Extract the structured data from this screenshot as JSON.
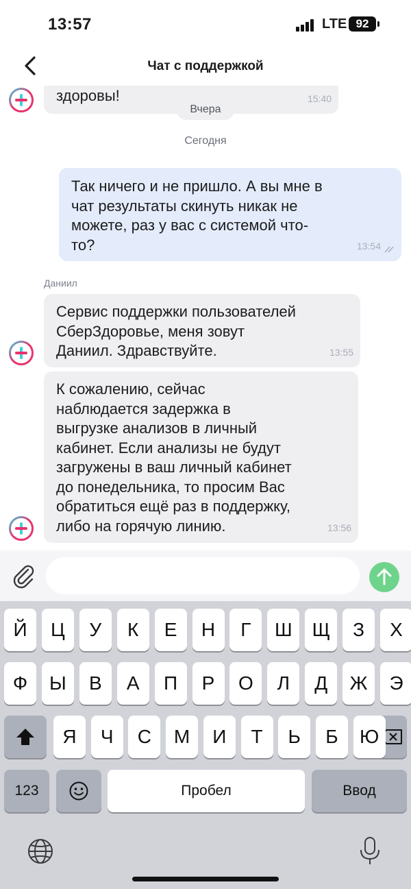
{
  "status_bar": {
    "time": "13:57",
    "network": "LTE",
    "battery": "92"
  },
  "header": {
    "title": "Чат с поддержкой"
  },
  "chat": {
    "prev_message": {
      "text": "здоровы!",
      "time": "15:40"
    },
    "day_yesterday": "Вчера",
    "day_today": "Сегодня",
    "outgoing": {
      "text": "Так ничего и не пришло. А вы мне в\nчат результаты скинуть никак не\nможете, раз у вас с системой что-\nто?",
      "time": "13:54"
    },
    "sender_name": "Даниил",
    "incoming": [
      {
        "text": "Сервис поддержки пользователей\nСберЗдоровье, меня зовут\nДаниил. Здравствуйте.",
        "time": "13:55"
      },
      {
        "text": "К сожалению, сейчас\nнаблюдается задержка в\nвыгрузке анализов в личный\nкабинет. Если анализы не будут\nзагружены в ваш личный кабинет\nдо понедельника, то просим Вас\nобратиться ещё раз в поддержку,\nлибо на горячую линию.",
        "time": "13:56"
      }
    ]
  },
  "input": {
    "placeholder": "",
    "value": ""
  },
  "keyboard": {
    "row1": [
      "Й",
      "Ц",
      "У",
      "К",
      "Е",
      "Н",
      "Г",
      "Ш",
      "Щ",
      "З",
      "Х"
    ],
    "row2": [
      "Ф",
      "Ы",
      "В",
      "А",
      "П",
      "Р",
      "О",
      "Л",
      "Д",
      "Ж",
      "Э"
    ],
    "row3": [
      "Я",
      "Ч",
      "С",
      "М",
      "И",
      "Т",
      "Ь",
      "Б",
      "Ю"
    ],
    "numbers_key": "123",
    "space_key": "Пробел",
    "return_key": "Ввод"
  },
  "icons": {
    "back": "chevron-left-icon",
    "avatar": "plus-logo-icon",
    "attach": "paperclip-icon",
    "send": "arrow-up-icon",
    "shift": "shift-icon",
    "delete": "backspace-icon",
    "emoji": "emoji-icon",
    "globe": "globe-icon",
    "mic": "microphone-icon",
    "read_status": "double-check-icon"
  },
  "colors": {
    "incoming_bubble": "#efeff1",
    "outgoing_bubble": "#e4ecfb",
    "send_button": "#6fd48b",
    "avatar_ring_start": "#e8336c",
    "avatar_ring_end": "#3ccfe0"
  }
}
